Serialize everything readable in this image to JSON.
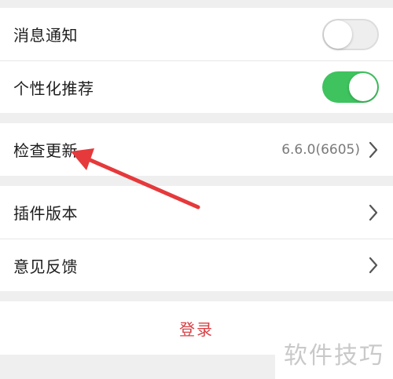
{
  "settings": {
    "notifications": {
      "label": "消息通知",
      "enabled": false
    },
    "personalized": {
      "label": "个性化推荐",
      "enabled": true
    },
    "check_update": {
      "label": "检查更新",
      "version": "6.6.0(6605)"
    },
    "plugin_version": {
      "label": "插件版本"
    },
    "feedback": {
      "label": "意见反馈"
    },
    "login": {
      "label": "登录"
    }
  },
  "watermark": "软件技巧",
  "colors": {
    "toggle_on": "#3ec35f",
    "login_text": "#d94045",
    "arrow": "#e5393b"
  }
}
